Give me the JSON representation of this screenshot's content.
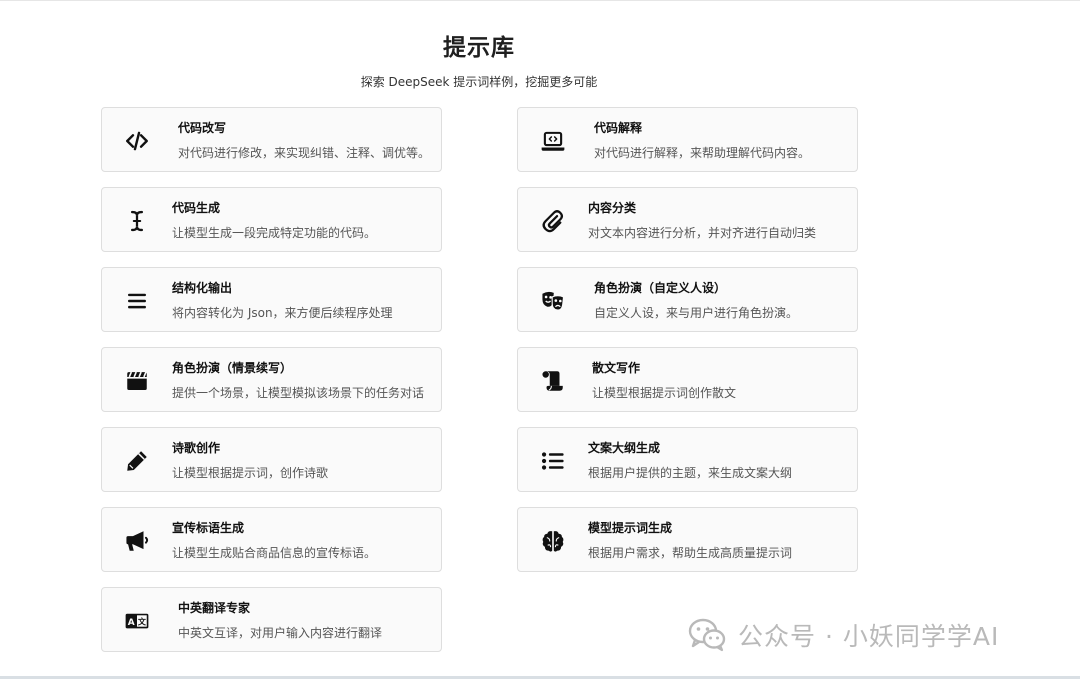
{
  "header": {
    "title": "提示库",
    "subtitle": "探索 DeepSeek 提示词样例，挖掘更多可能"
  },
  "cards": [
    {
      "title": "代码改写",
      "desc": "对代码进行修改，来实现纠错、注释、调优等。",
      "icon": "code-icon"
    },
    {
      "title": "代码解释",
      "desc": "对代码进行解释，来帮助理解代码内容。",
      "icon": "laptop-code-icon"
    },
    {
      "title": "代码生成",
      "desc": "让模型生成一段完成特定功能的代码。",
      "icon": "text-cursor-icon"
    },
    {
      "title": "内容分类",
      "desc": "对文本内容进行分析，并对齐进行自动归类",
      "icon": "paperclip-icon"
    },
    {
      "title": "结构化输出",
      "desc": "将内容转化为 Json，来方便后续程序处理",
      "icon": "bars-icon"
    },
    {
      "title": "角色扮演（自定义人设）",
      "desc": "自定义人设，来与用户进行角色扮演。",
      "icon": "theater-masks-icon"
    },
    {
      "title": "角色扮演（情景续写）",
      "desc": "提供一个场景，让模型模拟该场景下的任务对话",
      "icon": "clapperboard-icon"
    },
    {
      "title": "散文写作",
      "desc": "让模型根据提示词创作散文",
      "icon": "scroll-icon"
    },
    {
      "title": "诗歌创作",
      "desc": "让模型根据提示词，创作诗歌",
      "icon": "pen-icon"
    },
    {
      "title": "文案大纲生成",
      "desc": "根据用户提供的主题，来生成文案大纲",
      "icon": "list-icon"
    },
    {
      "title": "宣传标语生成",
      "desc": "让模型生成贴合商品信息的宣传标语。",
      "icon": "megaphone-icon"
    },
    {
      "title": "模型提示词生成",
      "desc": "根据用户需求，帮助生成高质量提示词",
      "icon": "brain-icon"
    },
    {
      "title": "中英翻译专家",
      "desc": "中英文互译，对用户输入内容进行翻译",
      "icon": "language-icon"
    }
  ],
  "watermark": {
    "text": "公众号 · 小妖同学学AI",
    "icon": "wechat-icon"
  }
}
